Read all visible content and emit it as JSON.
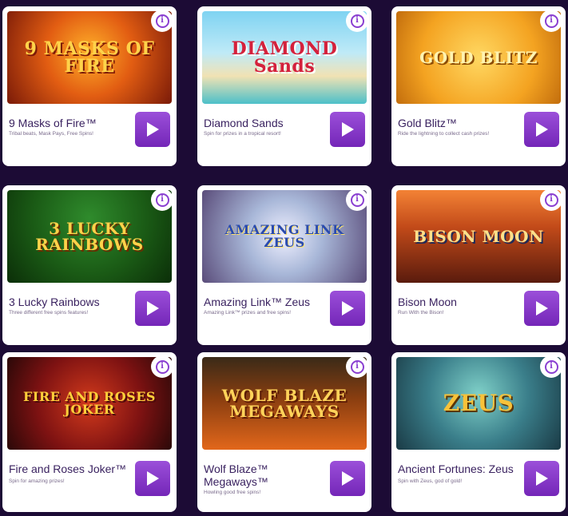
{
  "colors": {
    "page_background": "#1c0b35",
    "card_background": "#ffffff",
    "play_button": "#8a3fd1",
    "title_text": "#3a2260"
  },
  "games": [
    {
      "id": "masks",
      "name": "9 Masks of Fire™",
      "desc": "Tribal beats, Mask Pays, Free Spins!",
      "art_title": "9 MASKS OF FIRE",
      "icons": {
        "info": "info-icon",
        "play": "play-icon"
      }
    },
    {
      "id": "diamond",
      "name": "Diamond Sands",
      "desc": "Spin for prizes in a tropical resort!",
      "art_title": "DIAMOND Sands",
      "icons": {
        "info": "info-icon",
        "play": "play-icon"
      }
    },
    {
      "id": "gold",
      "name": "Gold Blitz™",
      "desc": "Ride the lightning to collect cash prizes!",
      "art_title": "GOLD BLITZ",
      "icons": {
        "info": "info-icon",
        "play": "play-icon"
      }
    },
    {
      "id": "lucky",
      "name": "3 Lucky Rainbows",
      "desc": "Three different free spins features!",
      "art_title": "3 LUCKY RAINBOWS",
      "icons": {
        "info": "info-icon",
        "play": "play-icon"
      }
    },
    {
      "id": "zeus1",
      "name": "Amazing Link™ Zeus",
      "desc": "Amazing Link™ prizes and free spins!",
      "art_title": "AMAZING LINK ZEUS",
      "icons": {
        "info": "info-icon",
        "play": "play-icon"
      }
    },
    {
      "id": "bison",
      "name": "Bison Moon",
      "desc": "Run With the Bison!",
      "art_title": "BISON MOON",
      "icons": {
        "info": "info-icon",
        "play": "play-icon"
      }
    },
    {
      "id": "joker",
      "name": "Fire and Roses Joker™",
      "desc": "Spin for amazing prizes!",
      "art_title": "FIRE AND ROSES JOKER",
      "icons": {
        "info": "info-icon",
        "play": "play-icon"
      }
    },
    {
      "id": "wolf",
      "name": "Wolf Blaze™ Megaways™",
      "desc": "Howling good free spins!",
      "art_title": "WOLF BLAZE MEGAWAYS",
      "icons": {
        "info": "info-icon",
        "play": "play-icon"
      }
    },
    {
      "id": "ancient",
      "name": "Ancient Fortunes: Zeus",
      "desc": "Spin with Zeus, god of gold!",
      "art_title": "ZEUS",
      "icons": {
        "info": "info-icon",
        "play": "play-icon"
      }
    }
  ]
}
